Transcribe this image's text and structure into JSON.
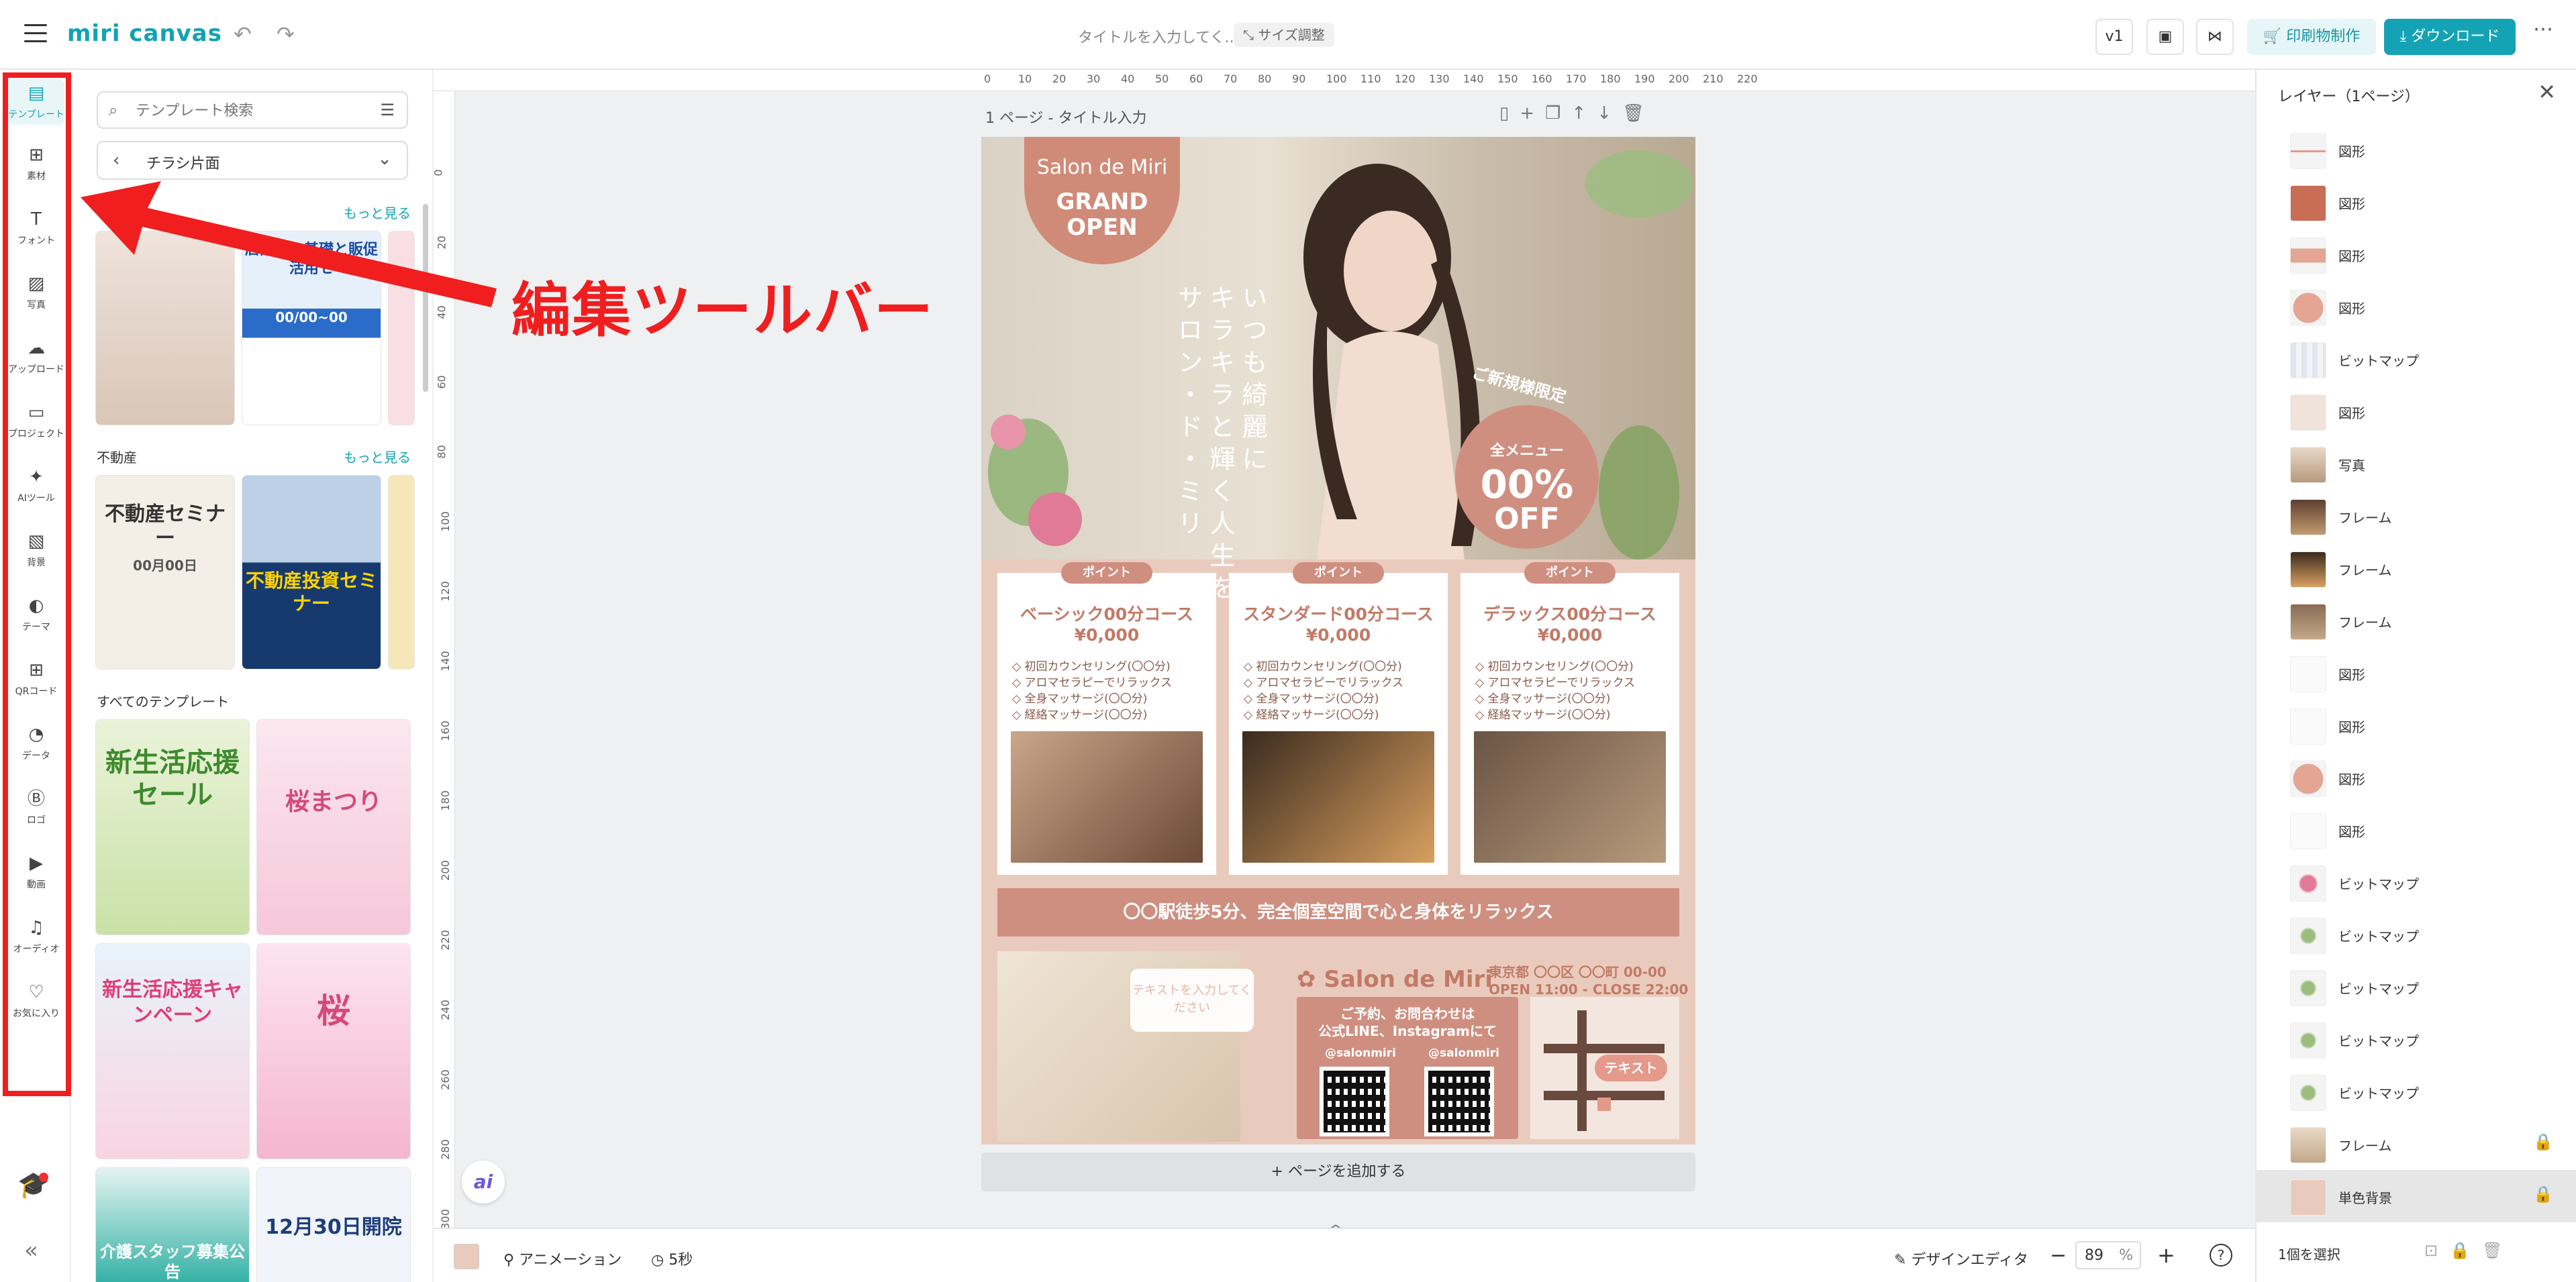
{
  "header": {
    "logo": "miri canvas",
    "doc_title_placeholder": "タイトルを入力してく...",
    "size_adjust": "サイズ調整",
    "version": "v1",
    "print_label": "印刷物制作",
    "download_label": "ダウンロード"
  },
  "toolbar": {
    "items": [
      {
        "label": "テンプレート",
        "icon": "template-icon"
      },
      {
        "label": "素材",
        "icon": "elements-icon"
      },
      {
        "label": "フォント",
        "icon": "font-icon"
      },
      {
        "label": "写真",
        "icon": "photo-icon"
      },
      {
        "label": "アップロード",
        "icon": "upload-icon"
      },
      {
        "label": "プロジェクト",
        "icon": "project-icon"
      },
      {
        "label": "AIツール",
        "icon": "ai-icon"
      },
      {
        "label": "背景",
        "icon": "background-icon"
      },
      {
        "label": "テーマ",
        "icon": "theme-icon"
      },
      {
        "label": "QRコード",
        "icon": "qr-icon"
      },
      {
        "label": "データ",
        "icon": "chart-icon"
      },
      {
        "label": "ロゴ",
        "icon": "logo-icon"
      },
      {
        "label": "動画",
        "icon": "video-icon"
      },
      {
        "label": "オーディオ",
        "icon": "audio-icon"
      },
      {
        "label": "お気に入り",
        "icon": "heart-icon"
      }
    ]
  },
  "annotation": {
    "label": "編集ツールバー",
    "color": "#f01e1e"
  },
  "template_panel": {
    "search_placeholder": "テンプレート検索",
    "category": "チラシ片面",
    "see_more": "もっと見る",
    "section_real_estate": "不動産",
    "section_all": "すべてのテンプレート",
    "thumb_texts": {
      "t1": "店舗での基礎と販促活用セ",
      "t2": "00/00~00",
      "re1": "不動産セミナー",
      "re1_sub": "00月00日",
      "re2": "不動産投資セミナー",
      "all1": "新生活応援セール",
      "all2": "桜まつり",
      "all3": "新生活応援キャンペーン",
      "all4": "桜",
      "all5": "介護スタッフ募集公告",
      "all6": "12月30日開院"
    }
  },
  "canvas": {
    "page_label": "1 ページ - タイトル入力",
    "add_page": "ページを追加する",
    "ruler_h": [
      "0",
      "10",
      "20",
      "30",
      "40",
      "50",
      "60",
      "70",
      "80",
      "90",
      "100",
      "110",
      "120",
      "130",
      "140",
      "150",
      "160",
      "170",
      "180",
      "190",
      "200",
      "210",
      "220"
    ],
    "ruler_v": [
      "0",
      "20",
      "40",
      "60",
      "80",
      "100",
      "120",
      "140",
      "160",
      "180",
      "200",
      "220",
      "240",
      "260",
      "280",
      "300"
    ]
  },
  "flyer": {
    "brand": "Salon de Miri",
    "grand_open": "GRAND OPEN",
    "vertical_1": "いつも綺麗に",
    "vertical_2": "キラキラと輝く人生を",
    "vertical_3": "サロン・ド・ミリ",
    "limited": "ご新規様限定",
    "all_menu": "全メニュー",
    "off_pct": "00%",
    "off": "OFF",
    "point": "ポイント",
    "courses": [
      {
        "name": "ベーシック00分コース",
        "price": "¥0,000"
      },
      {
        "name": "スタンダード00分コース",
        "price": "¥0,000"
      },
      {
        "name": "デラックス00分コース",
        "price": "¥0,000"
      }
    ],
    "course_items": [
      "◇ 初回カウンセリング(〇〇分)",
      "◇ アロマセラピーでリラックス",
      "◇ 全身マッサージ(〇〇分)",
      "◇ 経絡マッサージ(〇〇分)"
    ],
    "banner": "〇〇駅徒歩5分、完全個室空間で心と身体をリラックス",
    "text_placeholder": "テキストを入力してください",
    "address": "東京都 〇〇区 〇〇町 00-00",
    "hours": "OPEN 11:00 - CLOSE 22:00",
    "contact_1": "ご予約、お問合わせは",
    "contact_2": "公式LINE、Instagramにて",
    "handle_1": "@salonmiri",
    "handle_2": "@salonmiri",
    "map_text": "テキスト"
  },
  "layers": {
    "title": "レイヤー（1ページ）",
    "items": [
      {
        "name": "図形",
        "locked": false
      },
      {
        "name": "図形",
        "locked": false
      },
      {
        "name": "図形",
        "locked": false
      },
      {
        "name": "図形",
        "locked": false
      },
      {
        "name": "ビットマップ",
        "locked": false
      },
      {
        "name": "図形",
        "locked": false
      },
      {
        "name": "写真",
        "locked": false
      },
      {
        "name": "フレーム",
        "locked": false
      },
      {
        "name": "フレーム",
        "locked": false
      },
      {
        "name": "フレーム",
        "locked": false
      },
      {
        "name": "図形",
        "locked": false
      },
      {
        "name": "図形",
        "locked": false
      },
      {
        "name": "図形",
        "locked": false
      },
      {
        "name": "図形",
        "locked": false
      },
      {
        "name": "ビットマップ",
        "locked": false
      },
      {
        "name": "ビットマップ",
        "locked": false
      },
      {
        "name": "ビットマップ",
        "locked": false
      },
      {
        "name": "ビットマップ",
        "locked": false
      },
      {
        "name": "ビットマップ",
        "locked": false
      },
      {
        "name": "フレーム",
        "locked": true
      },
      {
        "name": "単色背景",
        "locked": true
      }
    ],
    "selected_count": "1個を選択"
  },
  "bottom": {
    "animation": "アニメーション",
    "duration": "5秒",
    "design_editor": "デザインエディタ",
    "zoom": "89",
    "zoom_unit": "%"
  },
  "colors": {
    "accent": "#14a3b5",
    "flyer_bg": "#e9cbbd",
    "salmon": "#cf8f80"
  }
}
